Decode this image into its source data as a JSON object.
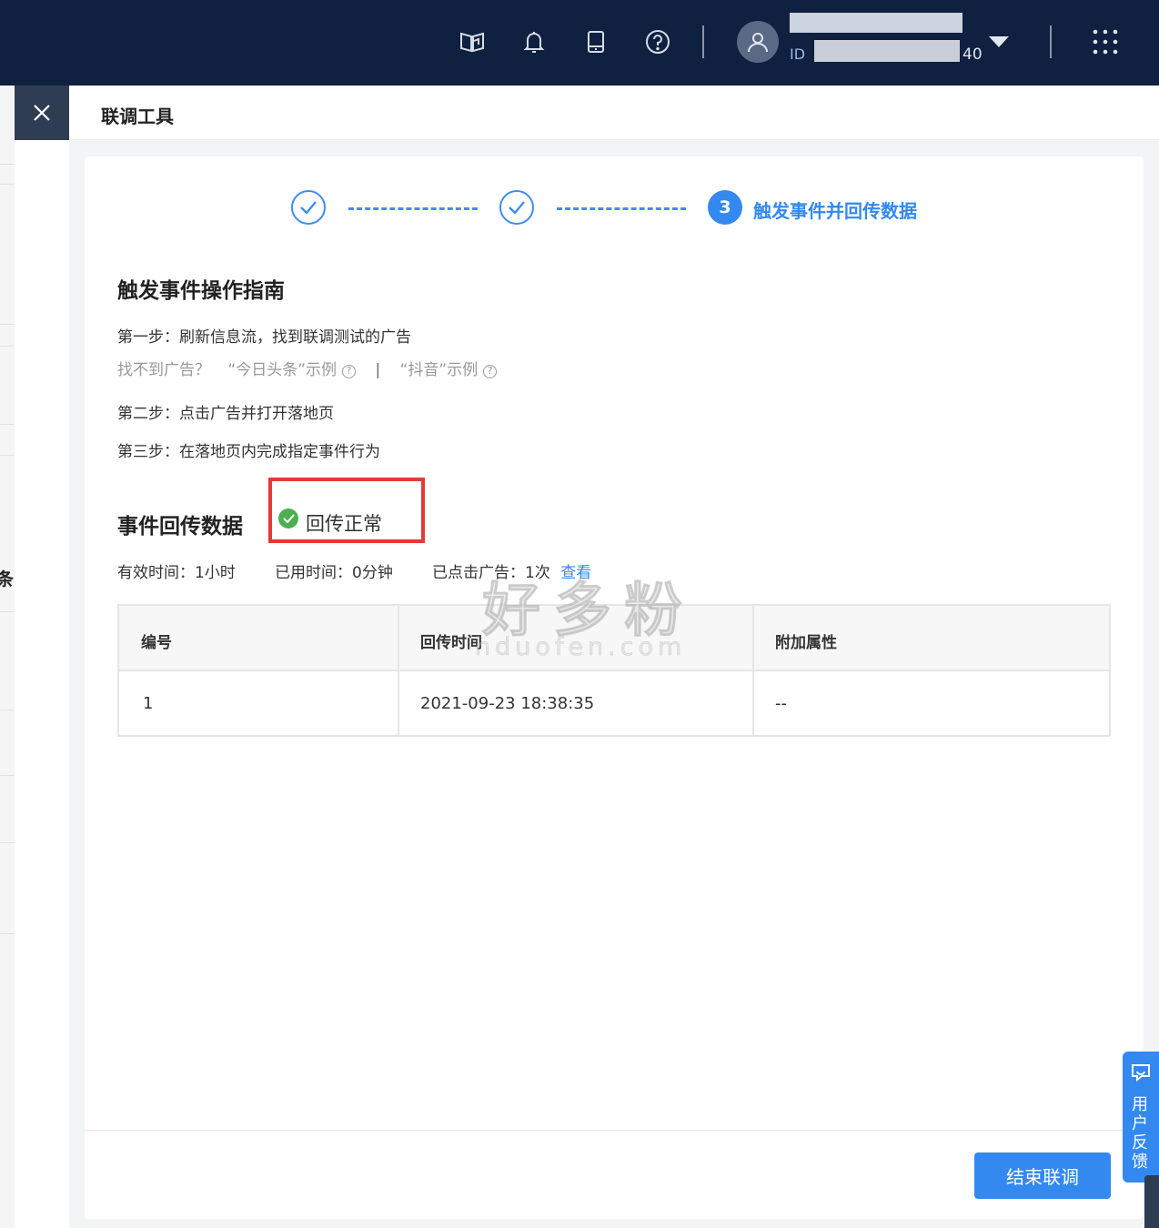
{
  "topbar": {
    "icons": [
      "book-icon",
      "bell-icon",
      "tablet-icon",
      "help-icon",
      "user-icon",
      "apps-grid-icon"
    ],
    "account_name": "···",
    "account_id_label": "ID",
    "account_id_tail": "40"
  },
  "left": {
    "background_text": "条"
  },
  "drawer": {
    "title": "联调工具",
    "steps": {
      "active_number": "3",
      "active_label": "触发事件并回传数据"
    },
    "guide": {
      "title": "触发事件操作指南",
      "step1": "第一步：刷新信息流，找到联调测试的广告",
      "hint_prefix": "找不到广告？",
      "hint_toutiao": "“今日头条”示例",
      "hint_separator": "|",
      "hint_douyin": "“抖音”示例",
      "step2": "第二步：点击广告并打开落地页",
      "step3": "第三步：在落地页内完成指定事件行为"
    },
    "callback": {
      "title": "事件回传数据",
      "status": "回传正常",
      "valid_time": "有效时间：1小时",
      "used_time": "已用时间：0分钟",
      "clicked": "已点击广告：1次",
      "view_link": "查看"
    },
    "table": {
      "headers": [
        "编号",
        "回传时间",
        "附加属性"
      ],
      "rows": [
        [
          "1",
          "2021-09-23 18:38:35",
          "--"
        ]
      ]
    },
    "end_button": "结束联调"
  },
  "watermark": {
    "cn": "好多粉",
    "en": "hduofen.com"
  },
  "feedback": {
    "label": "用户反馈"
  },
  "colors": {
    "navbar": "#0f2040",
    "primary": "#3389f0",
    "success": "#4caf50",
    "highlight_box": "#e53935"
  }
}
